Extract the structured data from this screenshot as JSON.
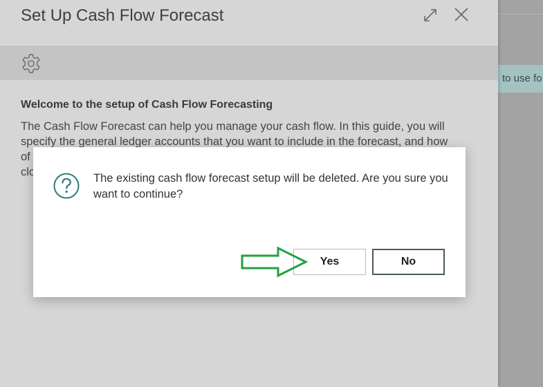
{
  "background": {
    "banner_text": "to use fo"
  },
  "panel": {
    "title": "Set Up Cash Flow Forecast",
    "icons": {
      "expand": "expand-icon",
      "close": "close-icon",
      "settings": "gear-icon"
    },
    "welcome_heading": "Welcome to the setup of Cash Flow Forecasting",
    "welcome_lines": [
      "The Cash Flow Forecast can help you manage your cash flow. In this guide, you will",
      "specify the general ledger accounts that you want to include in the forecast, and how",
      "of",
      "clo"
    ]
  },
  "dialog": {
    "icon": "question-icon",
    "message": "The existing cash flow forecast setup will be deleted. Are you sure you want to continue?",
    "yes_label": "Yes",
    "no_label": "No"
  },
  "annotation": {
    "arrow_color": "#22a040",
    "icon_accent": "#2f7a7a"
  }
}
